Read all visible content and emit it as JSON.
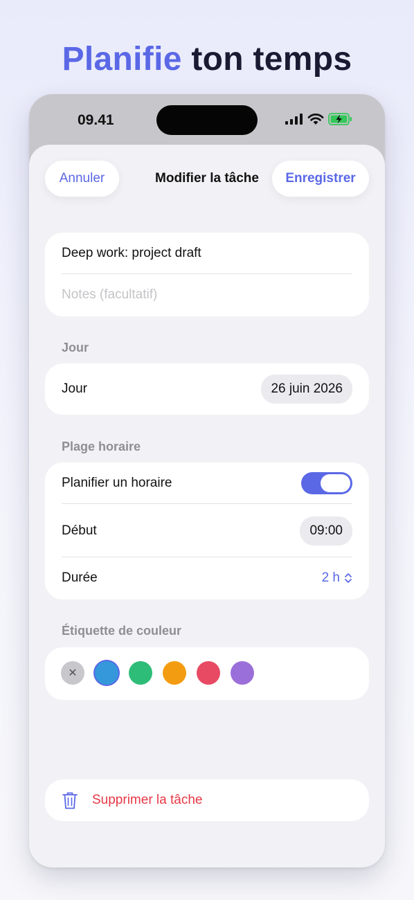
{
  "headline": {
    "accent": "Planifie",
    "rest": "ton temps"
  },
  "status_bar": {
    "time": "09.41",
    "icons": [
      "signal-icon",
      "wifi-icon",
      "battery-charging-icon"
    ]
  },
  "nav": {
    "cancel": "Annuler",
    "title": "Modifier la tâche",
    "save": "Enregistrer"
  },
  "task": {
    "title": "Deep work: project draft",
    "notes_placeholder": "Notes (facultatif)"
  },
  "day_section": {
    "header": "Jour",
    "label": "Jour",
    "value": "26 juin 2026"
  },
  "time_section": {
    "header": "Plage horaire",
    "schedule_label": "Planifier un horaire",
    "schedule_enabled": true,
    "start_label": "Début",
    "start_value": "09:00",
    "duration_label": "Durée",
    "duration_value": "2 h"
  },
  "color_section": {
    "header": "Étiquette de couleur",
    "options": [
      {
        "name": "none",
        "color": "#c7c7cc",
        "selected": false
      },
      {
        "name": "blue",
        "color": "#3498db",
        "selected": true
      },
      {
        "name": "green",
        "color": "#2ebd78",
        "selected": false
      },
      {
        "name": "orange",
        "color": "#f39c12",
        "selected": false
      },
      {
        "name": "red",
        "color": "#e84a64",
        "selected": false
      },
      {
        "name": "purple",
        "color": "#9b6fd9",
        "selected": false
      }
    ]
  },
  "delete": {
    "label": "Supprimer la tâche"
  },
  "colors": {
    "accent": "#5a68e6",
    "destructive": "#e63946"
  }
}
